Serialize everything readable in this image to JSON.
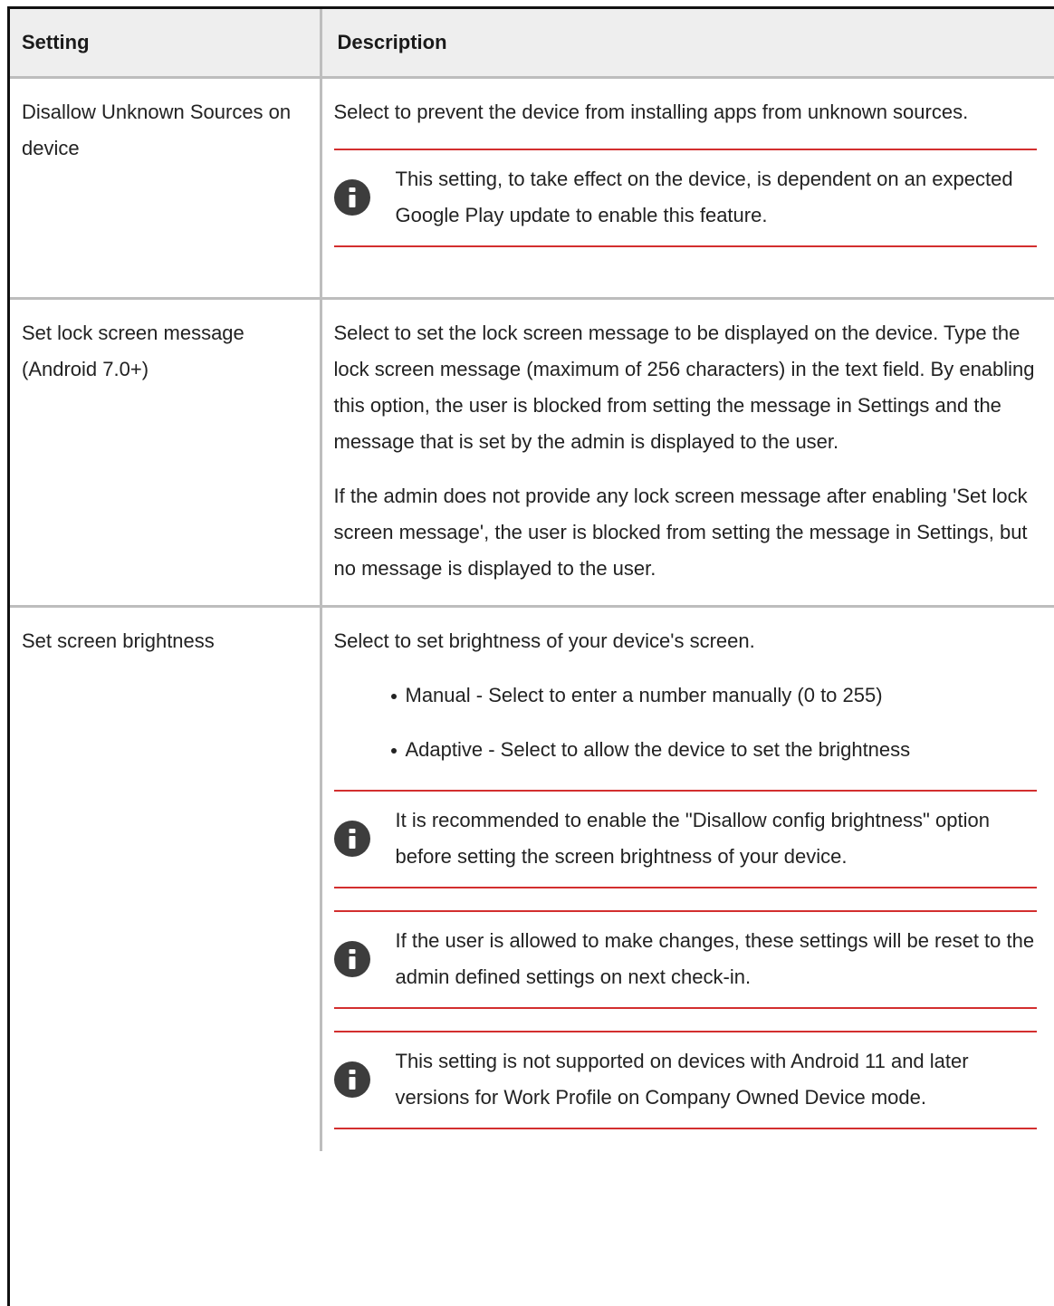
{
  "table": {
    "headers": {
      "setting": "Setting",
      "description": "Description"
    },
    "rows": [
      {
        "setting": "Disallow Unknown Sources on device",
        "paragraphs": [
          "Select to prevent the device from installing apps from unknown sources."
        ],
        "notes": [
          "This setting, to take effect on the device, is dependent on an expected Google Play update to enable this feature."
        ]
      },
      {
        "setting": "Set lock screen message (Android 7.0+)",
        "paragraphs": [
          "Select to set the lock screen message to be displayed on the device. Type the lock screen message (maximum of 256 characters) in the text field. By enabling this option, the user is blocked from setting the message in Settings and the message that is set by the admin is displayed to the user.",
          "If the admin does not provide any lock screen message after enabling 'Set lock screen message', the user is blocked from setting the message in Settings, but no message is displayed to the user."
        ]
      },
      {
        "setting": "Set screen brightness",
        "paragraphs": [
          "Select to set brightness of your device's screen."
        ],
        "bullets": [
          "Manual - Select to enter a number manually (0 to 255)",
          "Adaptive - Select to allow the device to set the brightness"
        ],
        "notes": [
          "It is recommended to enable the \"Disallow config brightness\" option before setting the screen brightness of your device.",
          "If the user is allowed to make changes, these settings will be reset to the admin defined settings on next check-in.",
          "This setting is not supported on devices with Android 11 and later versions for Work Profile on Company Owned Device mode."
        ]
      }
    ]
  },
  "icons": {
    "note": "info-icon"
  },
  "colors": {
    "note_rule": "#d32f2f",
    "header_bg": "#eeeeee",
    "icon_fill": "#3d3d3d",
    "grid": "#bdbdbd"
  }
}
